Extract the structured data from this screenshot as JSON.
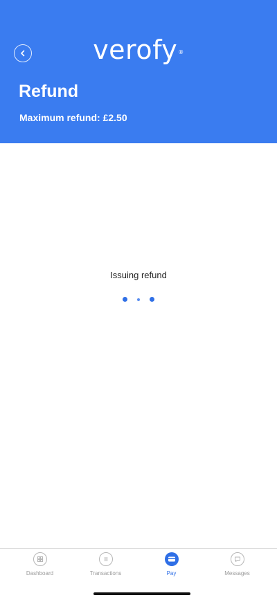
{
  "header": {
    "logo_text": "verofy",
    "logo_mark": "®",
    "title": "Refund",
    "subtitle": "Maximum refund: £2.50",
    "back_icon": "chevron-left-circle-icon",
    "background_color": "#3a7cf0"
  },
  "main": {
    "status_text": "Issuing refund",
    "loader_color": "#2f6fe6"
  },
  "bottom_nav": {
    "items": [
      {
        "label": "Dashboard",
        "icon": "dashboard-icon",
        "active": false
      },
      {
        "label": "Transactions",
        "icon": "transactions-icon",
        "active": false
      },
      {
        "label": "Pay",
        "icon": "pay-icon",
        "active": true
      },
      {
        "label": "Messages",
        "icon": "messages-icon",
        "active": false
      }
    ],
    "active_color": "#2f6fe6",
    "inactive_color": "#9a9a9a"
  }
}
